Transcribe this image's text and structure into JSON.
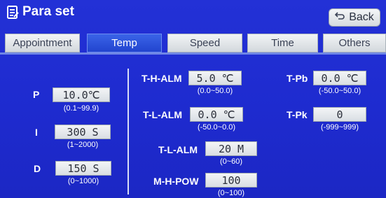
{
  "header": {
    "title": "Para set",
    "back_label": "Back"
  },
  "tabs": [
    {
      "label": "Appointment",
      "active": false
    },
    {
      "label": "Temp",
      "active": true
    },
    {
      "label": "Speed",
      "active": false
    },
    {
      "label": "Time",
      "active": false
    },
    {
      "label": "Others",
      "active": false
    }
  ],
  "left_params": {
    "p": {
      "label": "P",
      "value": "10.0℃",
      "range": "(0.1~99.9)"
    },
    "i": {
      "label": "I",
      "value": "300 S",
      "range": "(1~2000)"
    },
    "d": {
      "label": "D",
      "value": "150 S",
      "range": "(0~1000)"
    }
  },
  "mid_params": {
    "t_h_alm": {
      "label": "T-H-ALM",
      "value": "5.0 ℃",
      "range": "(0.0~50.0)"
    },
    "t_l_alm": {
      "label": "T-L-ALM",
      "value": "0.0 ℃",
      "range": "(-50.0~0.0)"
    },
    "t_l_alm_time": {
      "label": "T-L-ALM",
      "value": "20 M",
      "range": "(0~60)"
    },
    "m_h_pow": {
      "label": "M-H-POW",
      "value": "100",
      "range": "(0~100)"
    }
  },
  "right_params": {
    "t_pb": {
      "label": "T-Pb",
      "value": "0.0 ℃",
      "range": "(-50.0~50.0)"
    },
    "t_pk": {
      "label": "T-Pk",
      "value": "0",
      "range": "(-999~999)"
    }
  },
  "colors": {
    "background": "#1f2bd0",
    "active_tab": "#2a4fdc",
    "inactive_tab": "#e6e9ec",
    "field": "#e8ebee"
  }
}
